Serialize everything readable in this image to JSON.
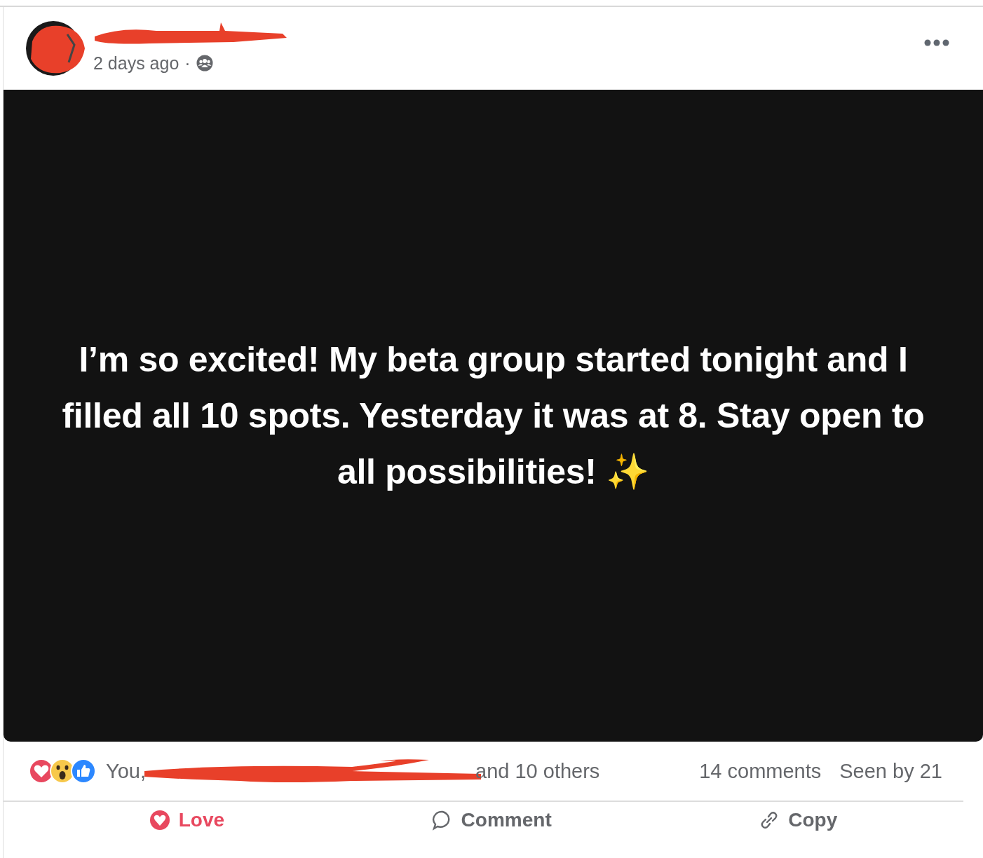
{
  "post": {
    "timestamp": "2 days ago",
    "separator": "·",
    "text": "I’m so excited! My beta group started tonight and I filled all 10 spots. Yesterday it was at 8. Stay open to all possibilities! ✨",
    "reactions": [
      {
        "kind": "love"
      },
      {
        "kind": "wow"
      },
      {
        "kind": "like"
      }
    ],
    "reacted_by_start": "You,",
    "reacted_by_end": "and 10 others",
    "comments": "14 comments",
    "seen_by": "Seen by 21"
  },
  "actions": [
    {
      "kind": "love",
      "label": "Love",
      "selected": true
    },
    {
      "kind": "comment",
      "label": "Comment",
      "selected": false
    },
    {
      "kind": "copy",
      "label": "Copy",
      "selected": false
    }
  ]
}
